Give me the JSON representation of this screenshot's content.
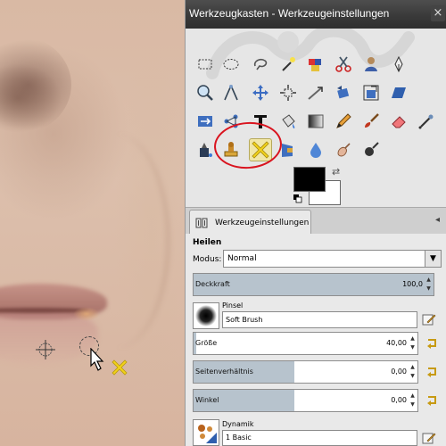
{
  "window": {
    "title": "Werkzeugkasten - Werkzeugeinstellungen",
    "close_glyph": "×"
  },
  "tools": [
    {
      "name": "rect-select-icon"
    },
    {
      "name": "ellipse-select-icon"
    },
    {
      "name": "free-select-icon"
    },
    {
      "name": "fuzzy-select-icon"
    },
    {
      "name": "select-by-color-icon"
    },
    {
      "name": "scissors-select-icon"
    },
    {
      "name": "foreground-select-icon"
    },
    {
      "name": "paths-icon"
    },
    {
      "name": "zoom-icon"
    },
    {
      "name": "measure-icon"
    },
    {
      "name": "move-icon"
    },
    {
      "name": "align-icon"
    },
    {
      "name": "crop-icon"
    },
    {
      "name": "rotate-icon"
    },
    {
      "name": "scale-icon"
    },
    {
      "name": "shear-icon"
    },
    {
      "name": "perspective-icon"
    },
    {
      "name": "flip-icon"
    },
    {
      "name": "cage-icon"
    },
    {
      "name": "text-icon"
    },
    {
      "name": "bucket-fill-icon"
    },
    {
      "name": "blend-icon"
    },
    {
      "name": "pencil-icon"
    },
    {
      "name": "paintbrush-icon"
    },
    {
      "name": "eraser-icon"
    },
    {
      "name": "airbrush-icon"
    },
    {
      "name": "ink-icon"
    },
    {
      "name": "clone-icon"
    },
    {
      "name": "heal-icon",
      "active": true
    },
    {
      "name": "perspective-clone-icon"
    },
    {
      "name": "blur-icon"
    },
    {
      "name": "smudge-icon"
    },
    {
      "name": "dodge-burn-icon"
    }
  ],
  "colors": {
    "foreground": "#000000",
    "background": "#ffffff",
    "highlight_ring": "#d9141f",
    "slider_fill": "#b7c3cd",
    "titlebar": "#3a3a3a"
  },
  "tab": {
    "label": "Werkzeugeinstellungen",
    "menu_glyph": "◂"
  },
  "options": {
    "title": "Heilen",
    "mode_label": "Modus:",
    "mode_value": "Normal",
    "opacity": {
      "label": "Deckkraft",
      "value": "100,0",
      "fraction": 1.0
    },
    "brush": {
      "header": "Pinsel",
      "name": "Soft Brush"
    },
    "size": {
      "label": "Größe",
      "value": "40,00",
      "fraction": 0.01
    },
    "aspect": {
      "label": "Seitenverhältnis",
      "value": "0,00",
      "fraction": 0.45
    },
    "angle": {
      "label": "Winkel",
      "value": "0,00",
      "fraction": 0.45
    },
    "dynamics": {
      "header": "Dynamik",
      "name": "1 Basic"
    }
  }
}
